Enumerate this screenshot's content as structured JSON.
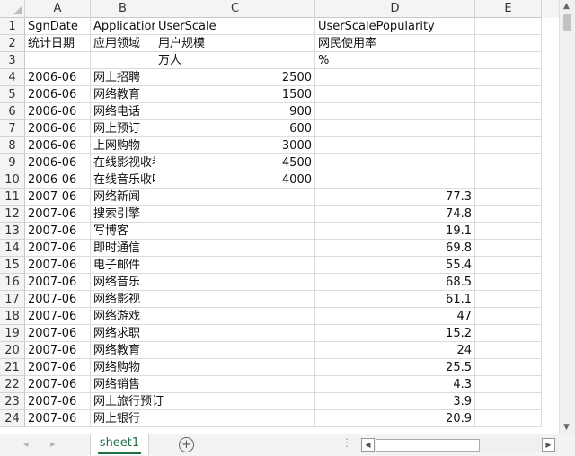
{
  "sheet": {
    "columns": [
      "A",
      "B",
      "C",
      "D",
      "E"
    ],
    "rows": [
      {
        "num": "1",
        "A": "SgnDate",
        "B": "ApplicationArea",
        "C": "UserScale",
        "D": "UserScalePopularity",
        "E": ""
      },
      {
        "num": "2",
        "A": "统计日期",
        "B": "应用领域",
        "C": "用户规模",
        "D": "网民使用率",
        "E": ""
      },
      {
        "num": "3",
        "A": "",
        "B": "",
        "C": "万人",
        "D": "%",
        "E": ""
      },
      {
        "num": "4",
        "A": "2006-06",
        "B": "网上招聘",
        "C": "2500",
        "D": "",
        "E": ""
      },
      {
        "num": "5",
        "A": "2006-06",
        "B": "网络教育",
        "C": "1500",
        "D": "",
        "E": ""
      },
      {
        "num": "6",
        "A": "2006-06",
        "B": "网络电话",
        "C": "900",
        "D": "",
        "E": ""
      },
      {
        "num": "7",
        "A": "2006-06",
        "B": "网上预订",
        "C": "600",
        "D": "",
        "E": ""
      },
      {
        "num": "8",
        "A": "2006-06",
        "B": "上网购物",
        "C": "3000",
        "D": "",
        "E": ""
      },
      {
        "num": "9",
        "A": "2006-06",
        "B": "在线影视收看",
        "C": "4500",
        "D": "",
        "E": ""
      },
      {
        "num": "10",
        "A": "2006-06",
        "B": "在线音乐收听",
        "C": "4000",
        "D": "",
        "E": ""
      },
      {
        "num": "11",
        "A": "2007-06",
        "B": "网络新闻",
        "C": "",
        "D": "77.3",
        "E": ""
      },
      {
        "num": "12",
        "A": "2007-06",
        "B": "搜索引擎",
        "C": "",
        "D": "74.8",
        "E": ""
      },
      {
        "num": "13",
        "A": "2007-06",
        "B": "写博客",
        "C": "",
        "D": "19.1",
        "E": ""
      },
      {
        "num": "14",
        "A": "2007-06",
        "B": "即时通信",
        "C": "",
        "D": "69.8",
        "E": ""
      },
      {
        "num": "15",
        "A": "2007-06",
        "B": "电子邮件",
        "C": "",
        "D": "55.4",
        "E": ""
      },
      {
        "num": "16",
        "A": "2007-06",
        "B": "网络音乐",
        "C": "",
        "D": "68.5",
        "E": ""
      },
      {
        "num": "17",
        "A": "2007-06",
        "B": "网络影视",
        "C": "",
        "D": "61.1",
        "E": ""
      },
      {
        "num": "18",
        "A": "2007-06",
        "B": "网络游戏",
        "C": "",
        "D": "47",
        "E": ""
      },
      {
        "num": "19",
        "A": "2007-06",
        "B": "网络求职",
        "C": "",
        "D": "15.2",
        "E": ""
      },
      {
        "num": "20",
        "A": "2007-06",
        "B": "网络教育",
        "C": "",
        "D": "24",
        "E": ""
      },
      {
        "num": "21",
        "A": "2007-06",
        "B": "网络购物",
        "C": "",
        "D": "25.5",
        "E": ""
      },
      {
        "num": "22",
        "A": "2007-06",
        "B": "网络销售",
        "C": "",
        "D": "4.3",
        "E": ""
      },
      {
        "num": "23",
        "A": "2007-06",
        "B": "网上旅行预订",
        "C": "",
        "D": "3.9",
        "E": ""
      },
      {
        "num": "24",
        "A": "2007-06",
        "B": "网上银行",
        "C": "",
        "D": "20.9",
        "E": ""
      }
    ]
  },
  "tabs": [
    {
      "label": "sheet1",
      "active": true
    }
  ],
  "icons": {
    "add_sheet": "plus-circle-icon",
    "nav_prev": "triangle-left-icon",
    "nav_next": "triangle-right-icon"
  },
  "colors": {
    "tab_accent": "#1e7145",
    "header_bg": "#f4f4f4",
    "gridline": "#dcdcdc"
  }
}
